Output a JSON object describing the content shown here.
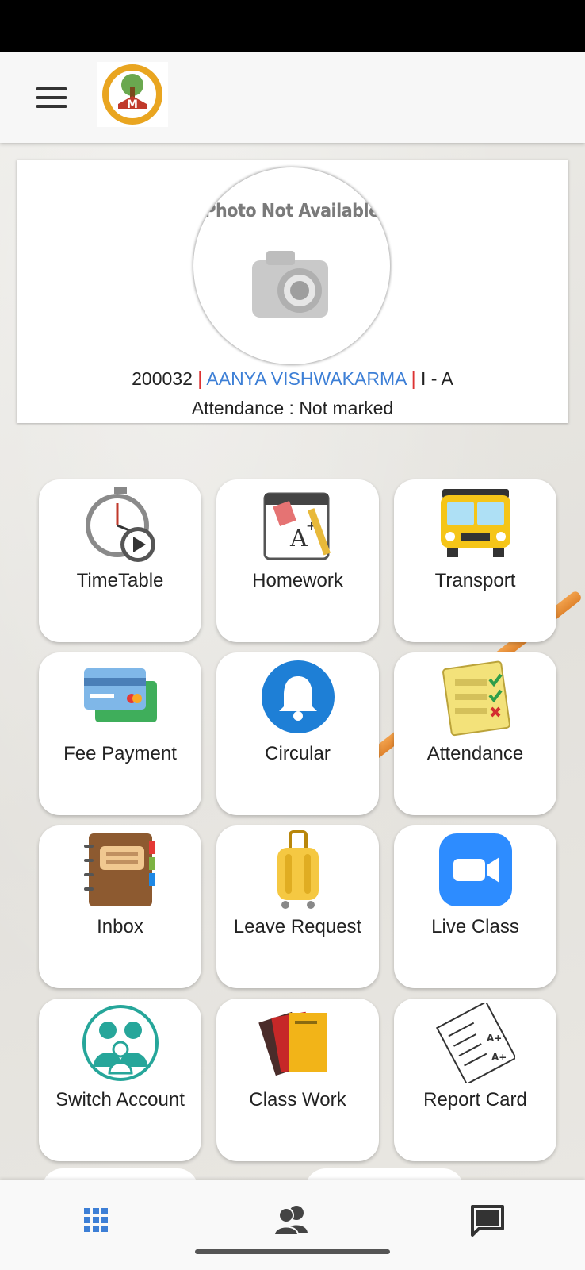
{
  "app_bar": {
    "menu_icon": "hamburger-menu-icon",
    "logo_icon": "school-logo-icon"
  },
  "profile": {
    "photo_text": "Photo Not Available",
    "admission_no": "200032",
    "separator": "|",
    "name": "AANYA VISHWAKARMA",
    "class_section": "I - A",
    "attendance": "Attendance : Not marked"
  },
  "tiles": [
    {
      "label": "TimeTable",
      "icon": "stopwatch-play-icon"
    },
    {
      "label": "Homework",
      "icon": "notebook-pencil-icon"
    },
    {
      "label": "Transport",
      "icon": "school-bus-icon"
    },
    {
      "label": "Fee Payment",
      "icon": "credit-cards-icon"
    },
    {
      "label": "Circular",
      "icon": "bell-icon"
    },
    {
      "label": "Attendance",
      "icon": "checklist-icon"
    },
    {
      "label": "Inbox",
      "icon": "address-book-icon"
    },
    {
      "label": "Leave Request",
      "icon": "luggage-icon"
    },
    {
      "label": "Live Class",
      "icon": "video-camera-icon"
    },
    {
      "label": "Switch Account",
      "icon": "family-icon"
    },
    {
      "label": "Class Work",
      "icon": "folders-icon"
    },
    {
      "label": "Report Card",
      "icon": "report-card-icon"
    }
  ],
  "bottom_nav": [
    {
      "icon": "grid-icon",
      "active": true
    },
    {
      "icon": "people-icon",
      "active": false
    },
    {
      "icon": "chat-icon",
      "active": false
    }
  ],
  "colors": {
    "accent": "#3d7fd6",
    "separator": "#dd3333",
    "status_bar": "#000000"
  }
}
